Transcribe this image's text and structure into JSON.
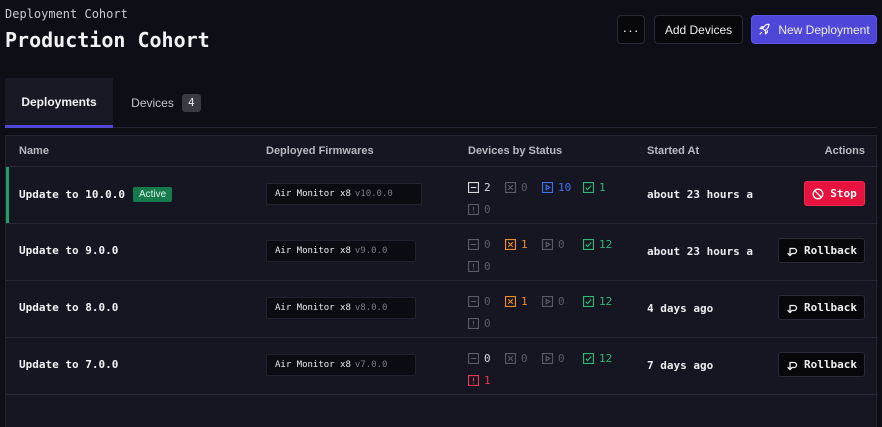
{
  "header": {
    "subtitle": "Deployment Cohort",
    "title": "Production Cohort",
    "more_label": "···",
    "add_devices_label": "Add Devices",
    "new_deployment_label": "New Deployment"
  },
  "tabs": [
    {
      "label": "Deployments",
      "active": true
    },
    {
      "label": "Devices",
      "count": "4",
      "active": false
    }
  ],
  "table": {
    "columns": [
      "Name",
      "Deployed Firmwares",
      "Devices by Status",
      "Started At",
      "Actions"
    ],
    "rows": [
      {
        "name": "Update to 10.0.0",
        "badge": "Active",
        "firmware_name": "Air Monitor x8",
        "firmware_version": "v10.0.0",
        "status": {
          "pending": "2",
          "cancelled": "0",
          "in_progress": "10",
          "succeeded": "1",
          "failed": "0"
        },
        "started_at": "about 23 hours a",
        "action": "Stop"
      },
      {
        "name": "Update to 9.0.0",
        "firmware_name": "Air Monitor x8",
        "firmware_version": "v9.0.0",
        "status": {
          "pending": "0",
          "cancelled": "1",
          "in_progress": "0",
          "succeeded": "12",
          "failed": "0"
        },
        "started_at": "about 23 hours a",
        "action": "Rollback"
      },
      {
        "name": "Update to 8.0.0",
        "firmware_name": "Air Monitor x8",
        "firmware_version": "v8.0.0",
        "status": {
          "pending": "0",
          "cancelled": "1",
          "in_progress": "0",
          "succeeded": "12",
          "failed": "0"
        },
        "started_at": "4 days ago",
        "action": "Rollback"
      },
      {
        "name": "Update to 7.0.0",
        "firmware_name": "Air Monitor x8",
        "firmware_version": "v7.0.0",
        "status": {
          "pending": "0",
          "cancelled": "0",
          "in_progress": "0",
          "succeeded": "12",
          "failed": "1"
        },
        "started_at": "7 days ago",
        "action": "Rollback"
      }
    ]
  },
  "colors": {
    "accent": "#4e46d8",
    "active_green": "#167a4c",
    "stop_red": "#e7123d",
    "in_progress_blue": "#3b73f0",
    "succeeded_green": "#2cb877",
    "cancelled_orange": "#ee8d2a",
    "failed_red": "#ee3650"
  }
}
